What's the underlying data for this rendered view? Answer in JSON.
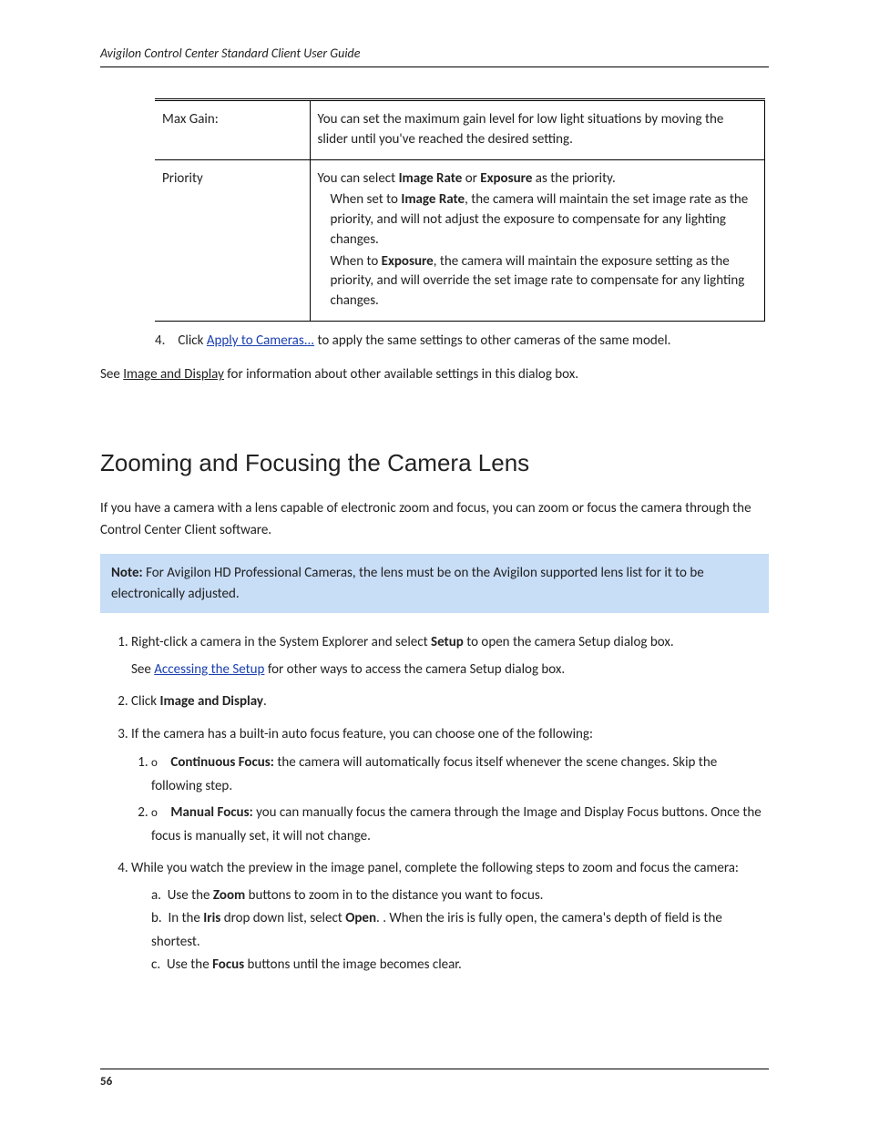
{
  "header": {
    "running": "Avigilon Control Center Standard Client User Guide"
  },
  "table": {
    "row1": {
      "label": "Max Gain:",
      "desc": "You can set the maximum gain level for low light situations by moving the slider until you've reached the desired setting."
    },
    "row2": {
      "label": "Priority",
      "desc_lead": "You can select",
      "opt1": "Image Rate",
      "mid1": "or",
      "opt2": "Exposure",
      "tail1": "as the priority.",
      "line2a": "When set to",
      "line2b": ", the camera will maintain the set image rate as the priority, and will not adjust the exposure to compensate for any lighting changes.",
      "line3a": "When to",
      "line3b": ", the camera will maintain the exposure setting as the priority, and will override the set image rate to compensate for any lighting changes."
    }
  },
  "step4": {
    "num": "4.",
    "lead": "Click",
    "btn": "Apply to Cameras...",
    "tail": "to apply the same settings to other cameras of the same model."
  },
  "seealso": {
    "lead": "See",
    "link": "Image and Display",
    "tail": "for information about other available settings in this dialog box."
  },
  "h2": "Zooming and Focusing the Camera Lens",
  "intro": "If you have a camera with a lens capable of electronic zoom and focus, you can zoom or focus the camera through the Control Center Client software.",
  "note": {
    "label": "Note:",
    "text": "For Avigilon HD Professional Cameras, the lens must be on the Avigilon supported lens list for it to be electronically adjusted."
  },
  "steps": {
    "s1a": "Right-click a camera in the System Explorer and select",
    "s1b": "Setup",
    "s1c": "to open the camera Setup",
    "s1d": "See",
    "s1link": "Accessing the Setup",
    "s1e": "for other ways to access the camera Setup",
    "s2a": "Click",
    "s2b": "Image and Display",
    "s3": "If the camera has a built-in auto focus feature, you can choose one of the following:",
    "s3o1a": "Continuous Focus:",
    "s3o1b": "the camera will automatically focus itself whenever the scene changes. Skip the following step.",
    "s3o2a": "Manual Focus:",
    "s3o2b": "you can manually focus the camera through the Image and Display Focus buttons. Once the focus is manually set, it will not change.",
    "s4": "While you watch the preview in the image panel, complete the following steps to zoom and focus the camera:",
    "s4a": "a.",
    "s4a_lead": "Use the",
    "s4a_b": "Zoom",
    "s4a_tail": "buttons to zoom in to the distance you want to focus.",
    "s4b": "b.",
    "s4b_lead": "In the",
    "s4b_b": "Iris",
    "s4b_mid": "drop down list, select",
    "s4b_b2": "Open",
    "s4b_tail": ". When the iris is fully open, the camera's depth of field is the shortest.",
    "s4c": "c.",
    "s4c_lead": "Use the",
    "s4c_b": "Focus",
    "s4c_tail": "buttons until the image becomes clear."
  },
  "footer": {
    "page": "56"
  },
  "dialog_word": "dialog box."
}
